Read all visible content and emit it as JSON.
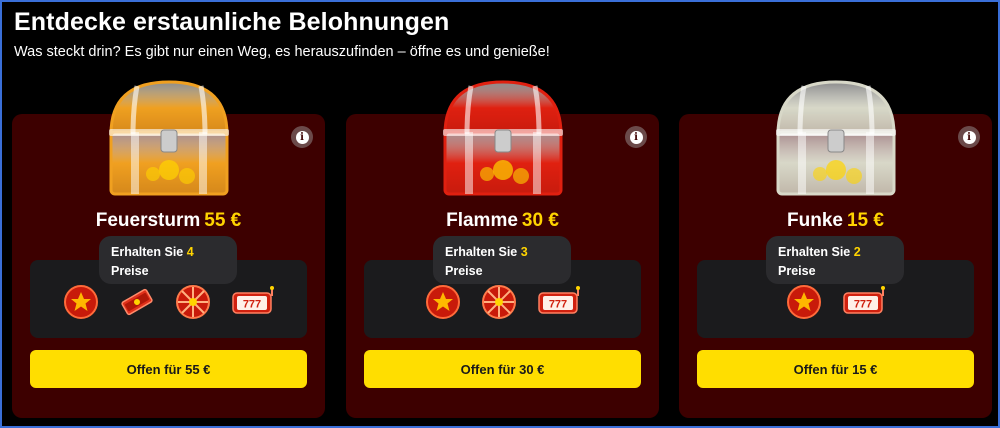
{
  "header": {
    "title": "Entdecke erstaunliche Belohnungen",
    "subtitle": "Was steckt drin? Es gibt nur einen Weg, es herauszufinden – öffne es und genieße!"
  },
  "cards": [
    {
      "name": "Feuersturm",
      "price": "55 €",
      "tooltip_prefix": "Erhalten Sie",
      "tooltip_count": "4",
      "tooltip_suffix": "Preise",
      "button_label": "Offen für 55 €",
      "chest_color": "#f0a020",
      "prizes": [
        "star-coin-icon",
        "cash-stack-icon",
        "prize-wheel-icon",
        "slot-reel-icon"
      ]
    },
    {
      "name": "Flamme",
      "price": "30 €",
      "tooltip_prefix": "Erhalten Sie",
      "tooltip_count": "3",
      "tooltip_suffix": "Preise",
      "button_label": "Offen für 30 €",
      "chest_color": "#e02010",
      "prizes": [
        "star-coin-icon",
        "prize-wheel-icon",
        "slot-reel-icon"
      ]
    },
    {
      "name": "Funke",
      "price": "15 €",
      "tooltip_prefix": "Erhalten Sie",
      "tooltip_count": "2",
      "tooltip_suffix": "Preise",
      "button_label": "Offen für 15 €",
      "chest_color": "#d8d8c8",
      "prizes": [
        "star-coin-icon",
        "slot-reel-icon"
      ]
    }
  ],
  "colors": {
    "card_bg": "#3d0000",
    "accent_yellow": "#ffd400",
    "button_yellow": "#ffde00",
    "prize_box_bg": "#1b1b1d"
  }
}
